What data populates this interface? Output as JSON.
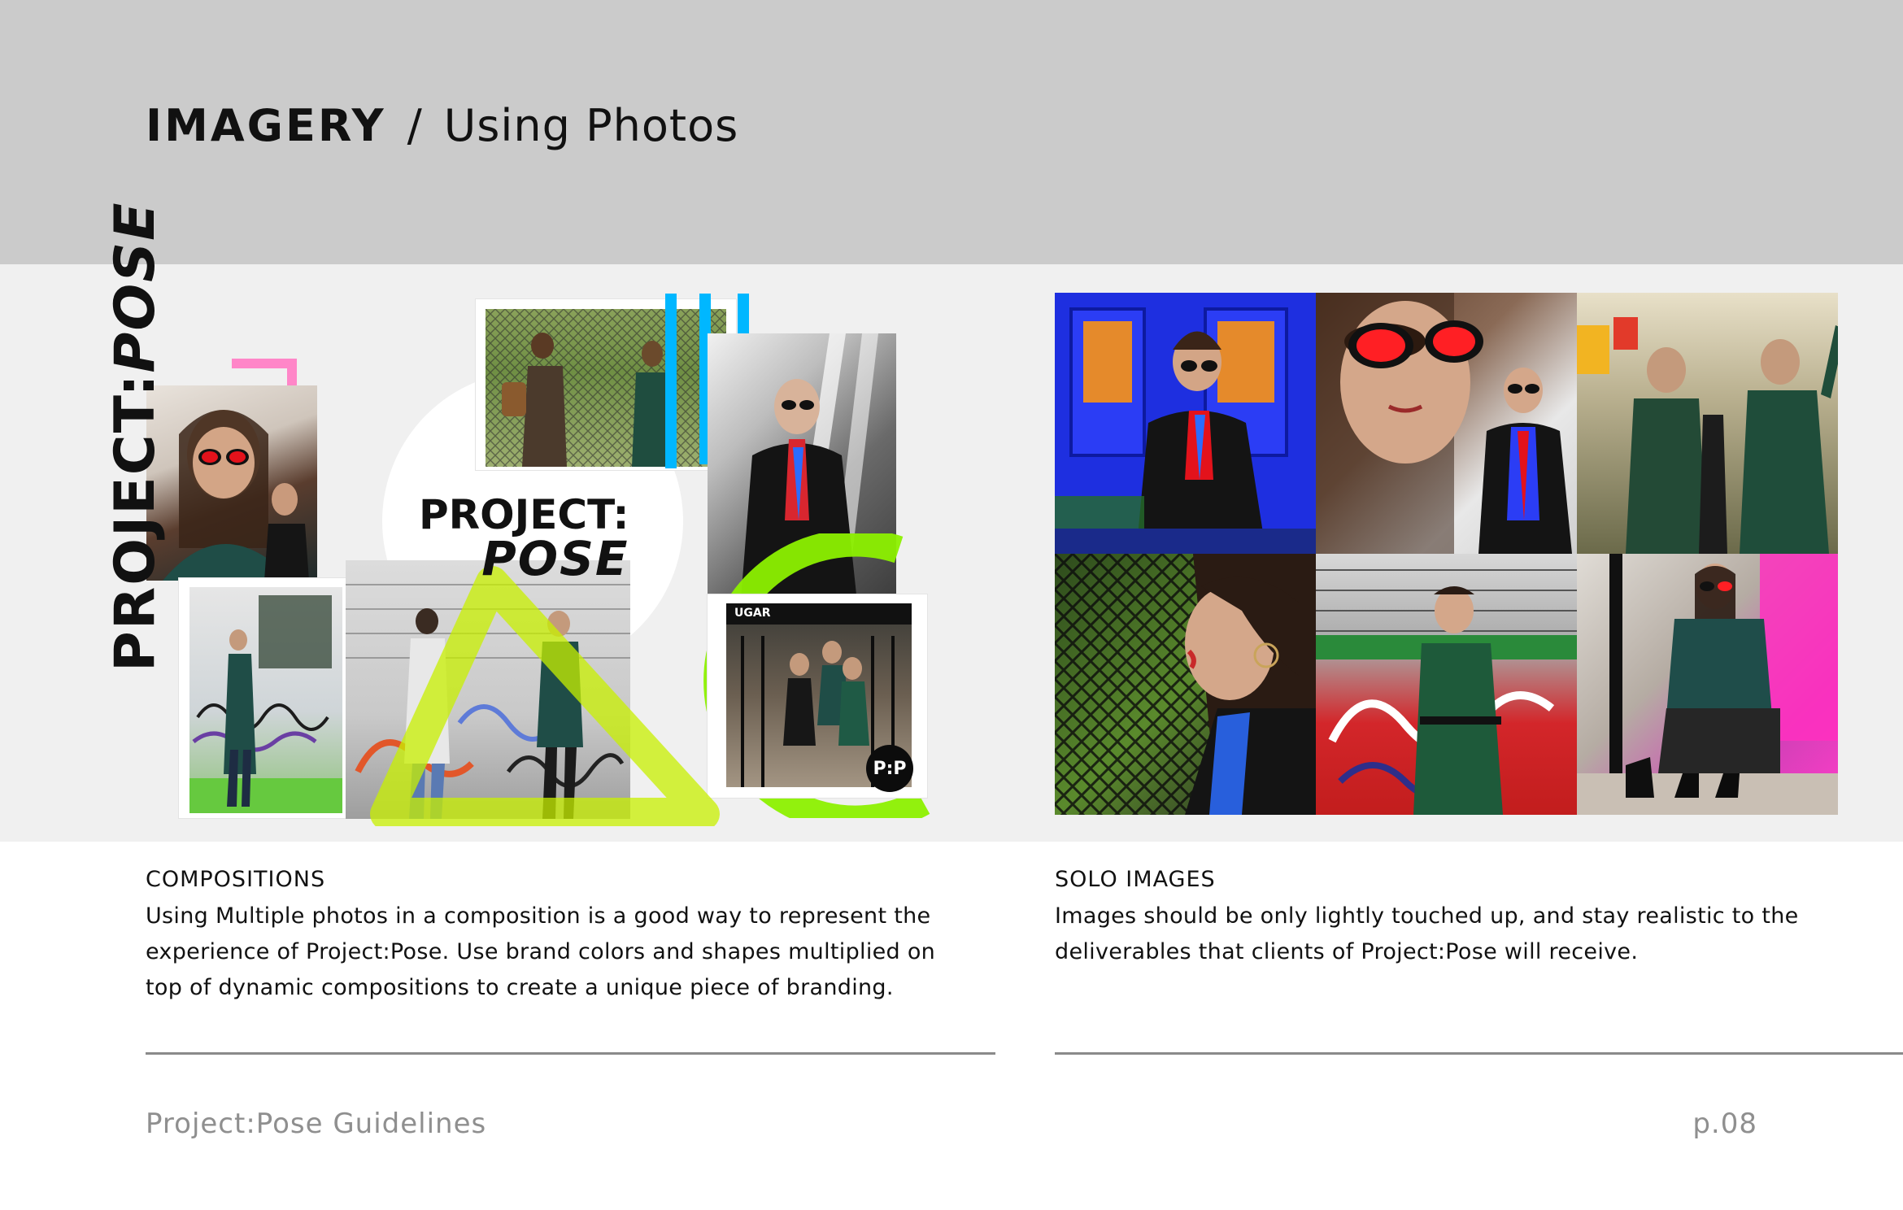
{
  "header": {
    "section": "IMAGERY",
    "separator": "/",
    "subtitle": "Using Photos",
    "band_color": "#cbcbcb"
  },
  "collage": {
    "vertical_logo_main": "PROJECT:",
    "vertical_logo_italic": "POSE",
    "logo_line1": "PROJECT:",
    "logo_line2": "POSE",
    "badge": "P:P",
    "shop_sign": "UGAR",
    "accent_colors": [
      "#ff86c8",
      "#00b7ff",
      "#c8f000",
      "#8cf000"
    ]
  },
  "compositions": {
    "title": "COMPOSITIONS",
    "body_lines": [
      "Using Multiple photos in a composition is a good way to represent the",
      "experience of Project:Pose. Use brand colors and shapes multiplied on",
      "top of dynamic compositions to create a unique piece of branding."
    ]
  },
  "solo_images": {
    "title": "SOLO IMAGES",
    "body_lines": [
      "Images should be only lightly touched up, and stay realistic to the",
      "deliverables that clients of Project:Pose will receive."
    ]
  },
  "footer": {
    "left": "Project:Pose Guidelines",
    "right": "p.08"
  }
}
